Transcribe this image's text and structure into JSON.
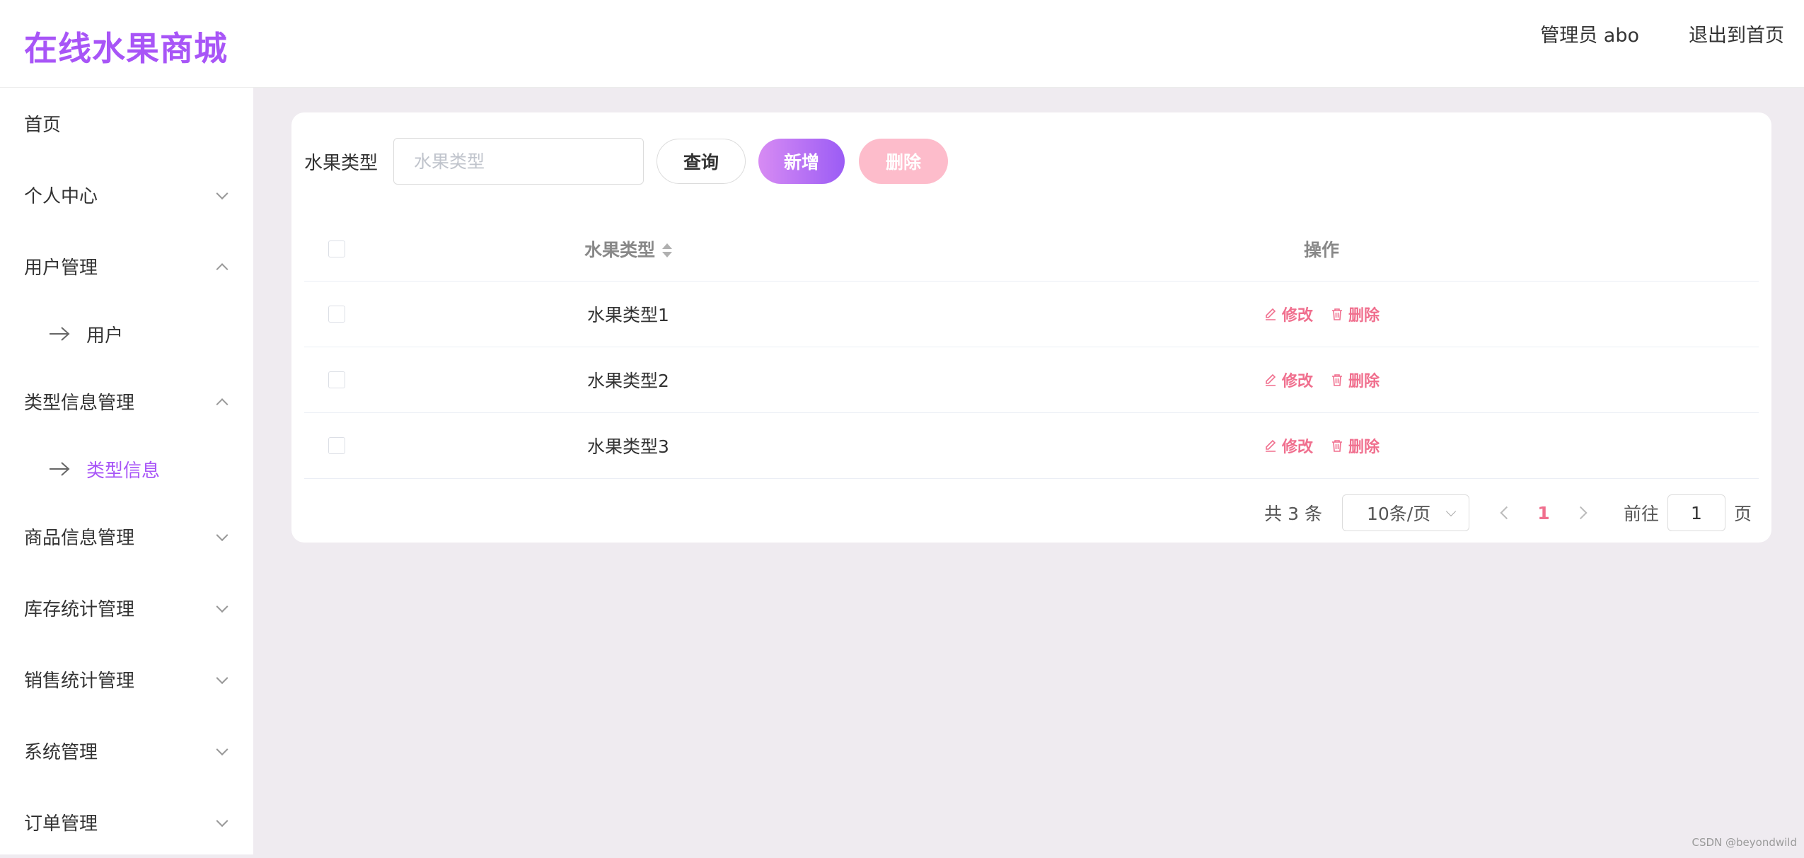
{
  "header": {
    "logo": "在线水果商城",
    "admin": "管理员 abo",
    "exit": "退出到首页"
  },
  "sidebar": {
    "items": [
      {
        "label": "首页"
      },
      {
        "label": "个人中心"
      },
      {
        "label": "用户管理"
      },
      {
        "label": "用户"
      },
      {
        "label": "类型信息管理"
      },
      {
        "label": "类型信息"
      },
      {
        "label": "商品信息管理"
      },
      {
        "label": "库存统计管理"
      },
      {
        "label": "销售统计管理"
      },
      {
        "label": "系统管理"
      },
      {
        "label": "订单管理"
      }
    ]
  },
  "toolbar": {
    "label": "水果类型",
    "search_placeholder": "水果类型",
    "search_value": "",
    "query": "查询",
    "add": "新增",
    "delete": "删除"
  },
  "table": {
    "headers": {
      "type": "水果类型",
      "op": "操作"
    },
    "rows": [
      {
        "type": "水果类型1"
      },
      {
        "type": "水果类型2"
      },
      {
        "type": "水果类型3"
      }
    ],
    "edit": "修改",
    "delete": "删除"
  },
  "pager": {
    "total": "共 3 条",
    "size": "10条/页",
    "current": "1",
    "goto_prefix": "前往",
    "goto_value": "1",
    "goto_suffix": "页"
  },
  "watermark": "CSDN @beyondwild",
  "colors": {
    "accent": "#a855f7",
    "danger": "#f06f8e"
  }
}
